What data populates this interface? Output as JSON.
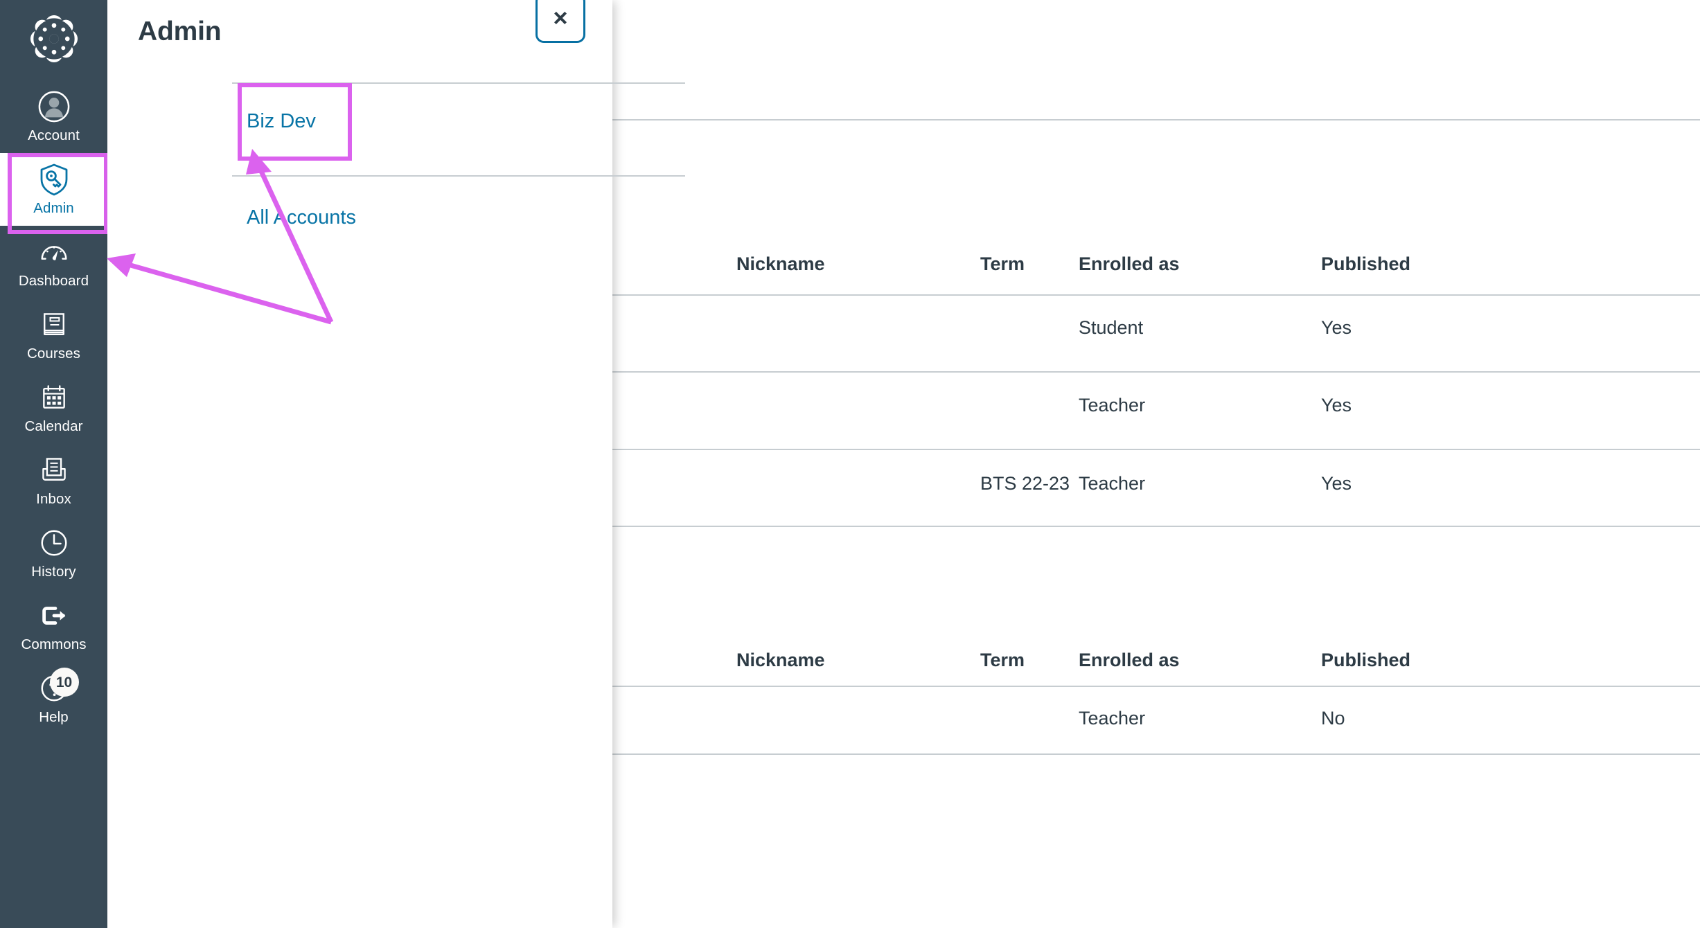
{
  "app": {
    "logo_icon": "canvas-logo-icon",
    "accent_blue": "#0874A6",
    "nav_bg": "#394B58",
    "highlight_magenta": "#DB62EE",
    "text_dark": "#2D3B45"
  },
  "global_nav": {
    "items": [
      {
        "label": "Account",
        "icon": "user-avatar-icon",
        "active": false
      },
      {
        "label": "Admin",
        "icon": "shield-key-icon",
        "active": true
      },
      {
        "label": "Dashboard",
        "icon": "speedometer-icon",
        "active": false
      },
      {
        "label": "Courses",
        "icon": "book-icon",
        "active": false
      },
      {
        "label": "Calendar",
        "icon": "calendar-icon",
        "active": false
      },
      {
        "label": "Inbox",
        "icon": "inbox-tray-icon",
        "active": false
      },
      {
        "label": "History",
        "icon": "clock-icon",
        "active": false
      },
      {
        "label": "Commons",
        "icon": "arrow-out-icon",
        "active": false
      },
      {
        "label": "Help",
        "icon": "question-mark-icon",
        "active": false,
        "badge": "10"
      }
    ]
  },
  "tray": {
    "title": "Admin",
    "close_icon": "close-x-icon",
    "close_label": "×",
    "account_link": "Biz Dev",
    "all_accounts_link": "All Accounts"
  },
  "page": {
    "tables": [
      {
        "columns": [
          "Nickname",
          "Term",
          "Enrolled as",
          "Published"
        ],
        "rows": [
          {
            "nickname": "",
            "term": "",
            "enrolled_as": "Student",
            "published": "Yes"
          },
          {
            "nickname": "",
            "term": "",
            "enrolled_as": "Teacher",
            "published": "Yes"
          },
          {
            "nickname": "",
            "term": "BTS 22-23",
            "enrolled_as": "Teacher",
            "published": "Yes"
          }
        ]
      },
      {
        "columns": [
          "Nickname",
          "Term",
          "Enrolled as",
          "Published"
        ],
        "rows": [
          {
            "nickname": "",
            "term": "",
            "enrolled_as": "Teacher",
            "published": "No"
          }
        ]
      }
    ]
  }
}
